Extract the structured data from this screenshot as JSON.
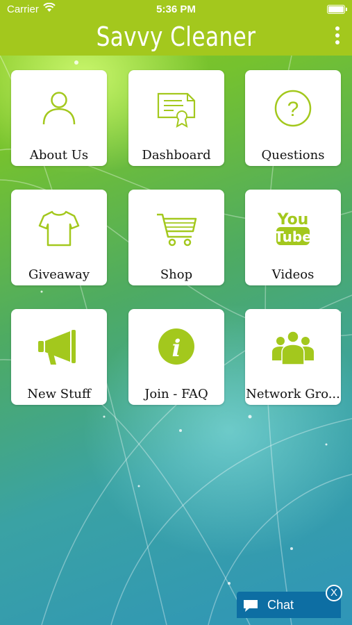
{
  "status_bar": {
    "carrier": "Carrier",
    "time": "5:36 PM"
  },
  "app_bar": {
    "title": "Savvy Cleaner",
    "menu_icon": "more-vertical-icon"
  },
  "colors": {
    "brand": "#a3c81d",
    "icon": "#a3c81d",
    "chat": "#0d6ea3"
  },
  "tiles": [
    {
      "label": "About Us",
      "icon": "person-icon"
    },
    {
      "label": "Dashboard",
      "icon": "certificate-icon"
    },
    {
      "label": "Questions",
      "icon": "question-icon"
    },
    {
      "label": "Giveaway",
      "icon": "tshirt-icon"
    },
    {
      "label": "Shop",
      "icon": "cart-icon"
    },
    {
      "label": "Videos",
      "icon": "youtube-icon"
    },
    {
      "label": "New Stuff",
      "icon": "megaphone-icon"
    },
    {
      "label": "Join - FAQ",
      "icon": "info-icon"
    },
    {
      "label": "Network Gro...",
      "icon": "group-icon"
    }
  ],
  "chat": {
    "label": "Chat",
    "close_label": "X"
  }
}
